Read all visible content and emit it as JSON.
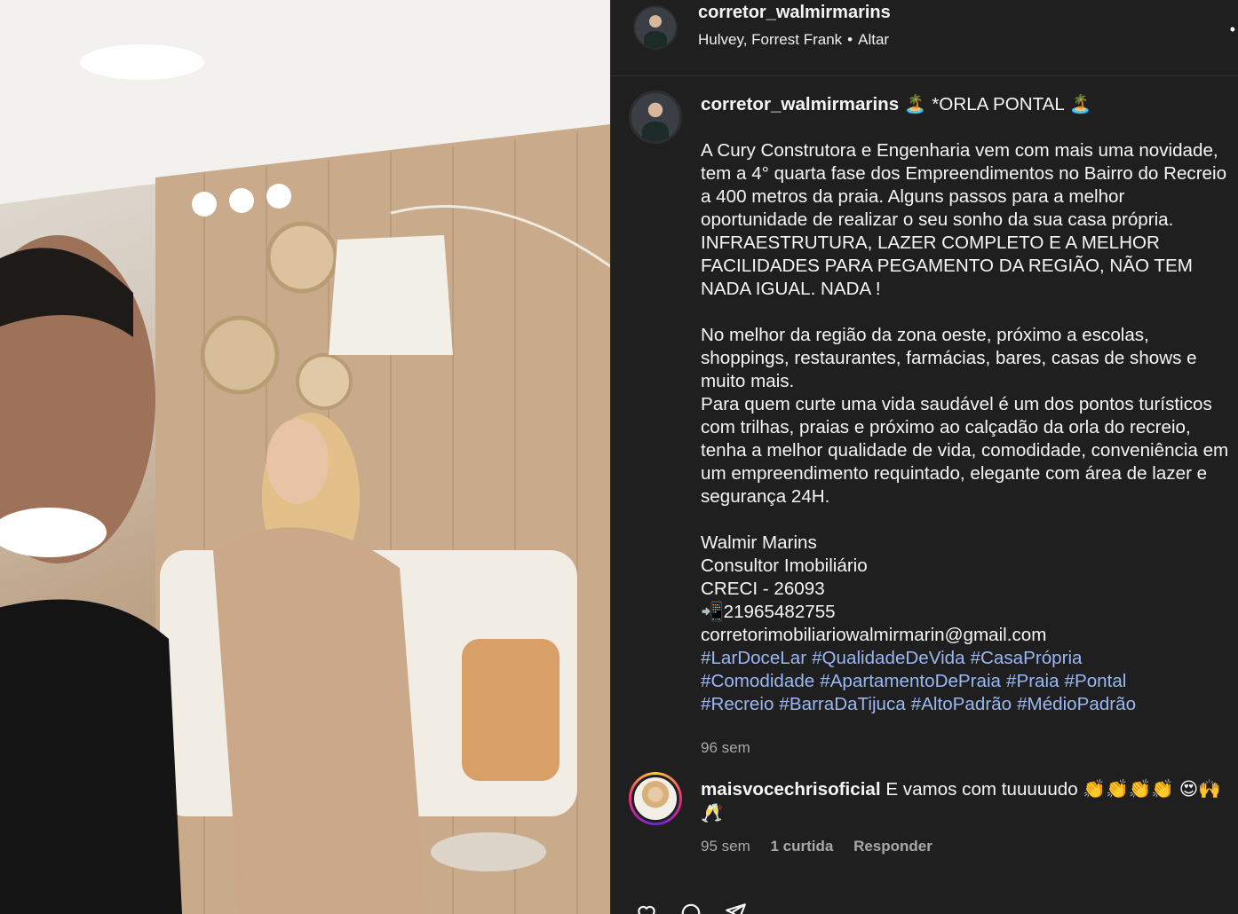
{
  "header": {
    "username": "corretor_walmirmarins",
    "audio_artists": "Hulvey, Forrest Frank",
    "audio_title": "Altar",
    "separator": "•",
    "more_glyph": "•"
  },
  "caption": {
    "username": "corretor_walmirmarins",
    "title": " 🏝️ *ORLA PONTAL 🏝️",
    "body": "A Cury Construtora e Engenharia vem com mais uma novidade, tem a 4° quarta fase dos Empreendimentos no Bairro do Recreio a 400 metros da praia. Alguns passos para a melhor oportunidade de realizar o seu sonho da sua casa própria. INFRAESTRUTURA, LAZER COMPLETO E A MELHOR FACILIDADES PARA PEGAMENTO DA REGIÃO, NÃO TEM NADA IGUAL. NADA !\n\nNo melhor da região da zona oeste, próximo a escolas, shoppings, restaurantes, farmácias, bares, casas de shows e muito mais.\nPara quem curte uma vida saudável é um dos pontos turísticos com trilhas, praias e próximo ao calçadão da orla do recreio, tenha a melhor qualidade de vida, comodidade, conveniência em um empreendimento requintado, elegante com área de lazer e segurança 24H.\n\nWalmir Marins\nConsultor Imobiliário\nCRECI - 26093\n📲21965482755\ncorretorimobiliariowalmirmarin@gmail.com",
    "hashtags": [
      "#LarDoceLar",
      "#QualidadeDeVida",
      "#CasaPrópria",
      "#Comodidade",
      "#ApartamentoDePraia",
      "#Praia",
      "#Pontal",
      "#Recreio",
      "#BarraDaTijuca",
      "#AltoPadrão",
      "#MédioPadrão"
    ],
    "time": "96 sem"
  },
  "comment": {
    "username": "maisvocechrisoficial",
    "text": " E vamos com tuuuuudo 👏👏👏👏 😍🙌🥂",
    "time": "95 sem",
    "likes": "1 curtida",
    "reply_label": "Responder"
  },
  "icons": {
    "like": "heart-icon",
    "comment": "comment-icon",
    "share": "share-icon"
  }
}
